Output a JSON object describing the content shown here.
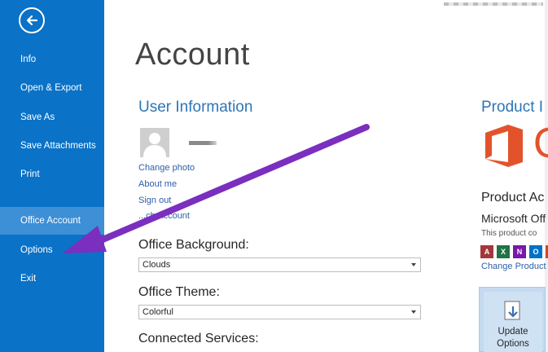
{
  "sidebar": {
    "items": [
      {
        "label": "Info"
      },
      {
        "label": "Open & Export"
      },
      {
        "label": "Save As"
      },
      {
        "label": "Save Attachments"
      },
      {
        "label": "Print"
      },
      {
        "label": "Office Account",
        "selected": true
      },
      {
        "label": "Options"
      },
      {
        "label": "Exit"
      }
    ]
  },
  "main": {
    "title": "Account",
    "user_info": {
      "heading": "User Information",
      "links": [
        "Change photo",
        "About me",
        "Sign out",
        "...ch Account"
      ]
    },
    "office_background": {
      "label": "Office Background:",
      "value": "Clouds"
    },
    "office_theme": {
      "label": "Office Theme:",
      "value": "Colorful"
    },
    "connected_services": {
      "label": "Connected Services:"
    }
  },
  "product": {
    "heading": "Product I",
    "logo_letter": "O",
    "activated": "Product Ac",
    "name": "Microsoft Off",
    "note": "This product co",
    "app_icons": [
      {
        "letter": "A",
        "color": "#a4373a"
      },
      {
        "letter": "X",
        "color": "#217346"
      },
      {
        "letter": "N",
        "color": "#7719aa"
      },
      {
        "letter": "O",
        "color": "#0072c6"
      },
      {
        "letter": "P",
        "color": "#d24726"
      }
    ],
    "change_link": "Change Product",
    "update_button": {
      "line1": "Update",
      "line2": "Options"
    }
  },
  "colors": {
    "sidebar": "#0a72c7",
    "sidebar_selected": "#3d8fd6",
    "heading_blue": "#2e75b6",
    "office_orange": "#e3532b",
    "annotation_arrow": "#7a2fbf"
  }
}
